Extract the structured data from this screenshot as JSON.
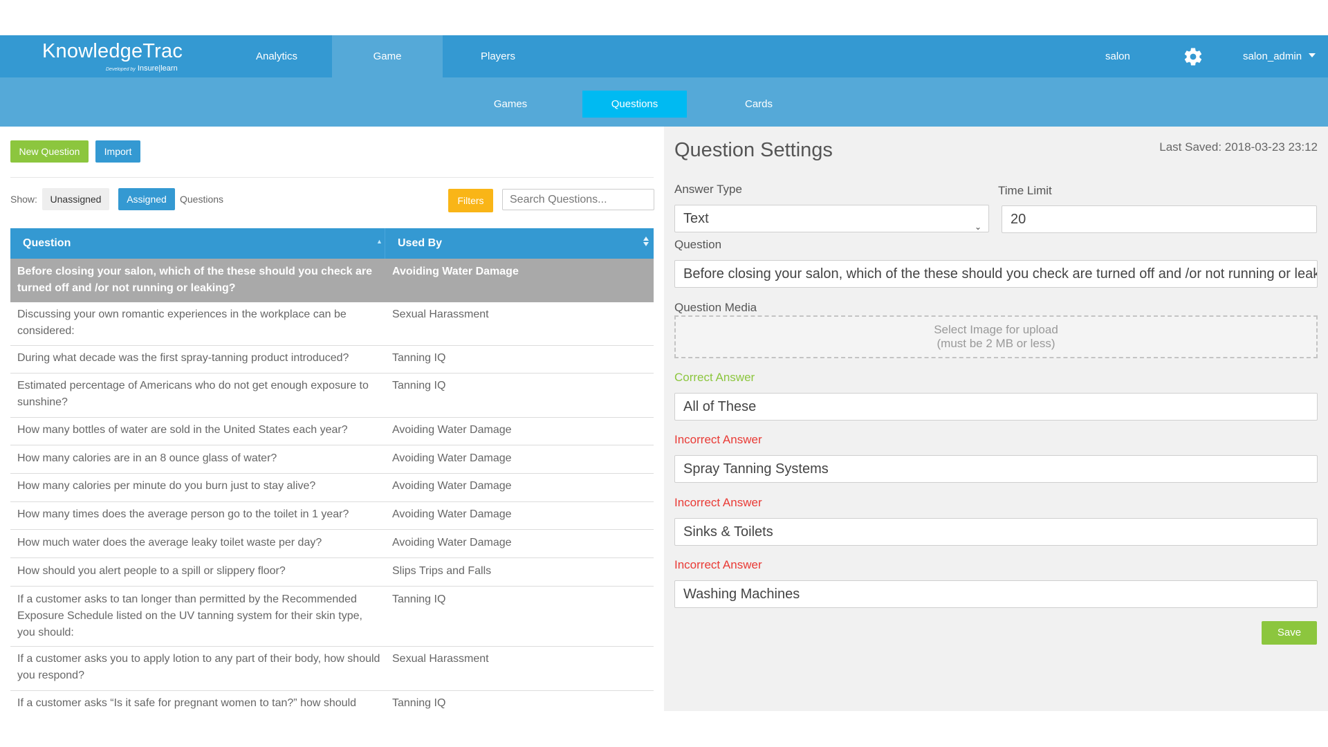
{
  "app": {
    "logo_main": "KnowledgeTrac",
    "logo_sub_small": "Developed by",
    "logo_sub": "Insure|learn"
  },
  "nav": {
    "items": [
      {
        "label": "Analytics"
      },
      {
        "label": "Game"
      },
      {
        "label": "Players"
      }
    ],
    "active": "Game",
    "org": "salon",
    "user": "salon_admin"
  },
  "subnav": {
    "items": [
      {
        "label": "Games"
      },
      {
        "label": "Questions"
      },
      {
        "label": "Cards"
      }
    ],
    "active": "Questions"
  },
  "left": {
    "new_question": "New Question",
    "import": "Import",
    "show_label": "Show:",
    "unassigned": "Unassigned",
    "assigned": "Assigned",
    "questions_label": "Questions",
    "filters": "Filters",
    "search_placeholder": "Search Questions...",
    "table": {
      "headers": {
        "question": "Question",
        "used_by": "Used By"
      },
      "rows": [
        {
          "question": "Before closing your salon, which of the these should you check are turned off and /or not running or leaking?",
          "used_by": "Avoiding Water Damage",
          "selected": true
        },
        {
          "question": "Discussing your own romantic experiences in the workplace can be considered:",
          "used_by": "Sexual Harassment"
        },
        {
          "question": "During what decade was the first spray-tanning product introduced?",
          "used_by": "Tanning IQ"
        },
        {
          "question": "Estimated percentage of Americans who do not get enough exposure to sunshine?",
          "used_by": "Tanning IQ"
        },
        {
          "question": "How many bottles of water are sold in the United States each year?",
          "used_by": "Avoiding Water Damage"
        },
        {
          "question": "How many calories are in an 8 ounce glass of water?",
          "used_by": "Avoiding Water Damage"
        },
        {
          "question": "How many calories per minute do you burn just to stay alive?",
          "used_by": "Avoiding Water Damage"
        },
        {
          "question": "How many times does the average person go to the toilet in 1 year?",
          "used_by": "Avoiding Water Damage"
        },
        {
          "question": "How much water does the average leaky toilet waste per day?",
          "used_by": "Avoiding Water Damage"
        },
        {
          "question": "How should you alert people to a spill or slippery floor?",
          "used_by": "Slips Trips and Falls"
        },
        {
          "question": "If a customer asks to tan longer than permitted by the Recommended Exposure Schedule listed on the UV tanning system for their skin type, you should:",
          "used_by": "Tanning IQ"
        },
        {
          "question": "If a customer asks you to apply lotion to any part of their body, how should you respond?",
          "used_by": "Sexual Harassment"
        },
        {
          "question": "If a customer asks “Is it safe for pregnant women to tan?” how should",
          "used_by": "Tanning IQ"
        }
      ]
    }
  },
  "settings": {
    "title": "Question Settings",
    "last_saved": "Last Saved: 2018-03-23 23:12",
    "answer_type_label": "Answer Type",
    "answer_type_value": "Text",
    "time_limit_label": "Time Limit",
    "time_limit_value": "20",
    "question_label": "Question",
    "question_value": "Before closing your salon, which of the these should you check are turned off and /or not running or leaking?",
    "media_label": "Question Media",
    "media_line1": "Select Image for upload",
    "media_line2": "(must be 2 MB or less)",
    "correct_label": "Correct Answer",
    "correct_value": "All of These",
    "incorrect": [
      {
        "label": "Incorrect Answer",
        "value": "Spray Tanning Systems"
      },
      {
        "label": "Incorrect Answer",
        "value": "Sinks & Toilets"
      },
      {
        "label": "Incorrect Answer",
        "value": "Washing Machines"
      }
    ],
    "save": "Save"
  }
}
